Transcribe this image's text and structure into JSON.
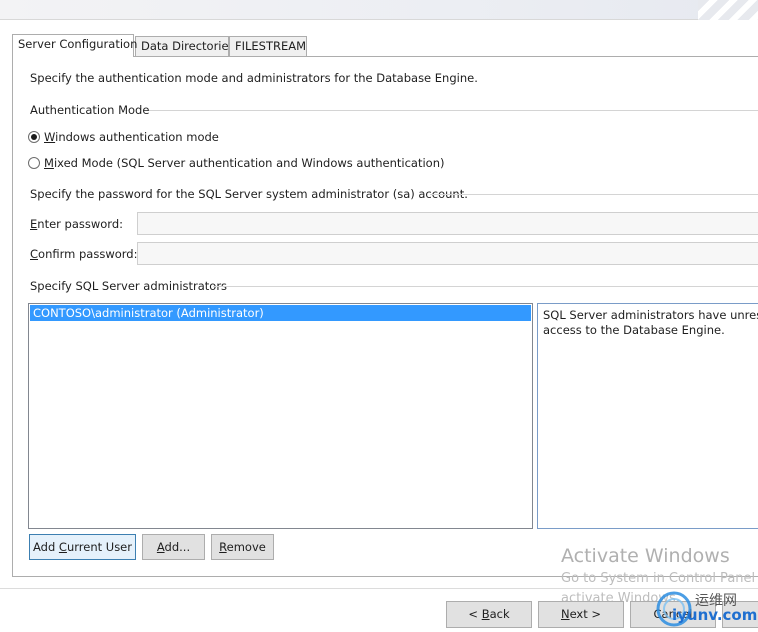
{
  "tabs": [
    {
      "label": "Server Configuration",
      "active": true
    },
    {
      "label": "Data Directories",
      "active": false
    },
    {
      "label": "FILESTREAM",
      "active": false
    }
  ],
  "server_config": {
    "description": "Specify the authentication mode and administrators for the Database Engine.",
    "auth_mode": {
      "group_label": "Authentication Mode",
      "windows": {
        "prefix": "",
        "accel": "W",
        "rest": "indows authentication mode",
        "checked": true
      },
      "mixed": {
        "prefix": "",
        "accel": "M",
        "rest": "ixed Mode (SQL Server authentication and Windows authentication)",
        "checked": false
      }
    },
    "sa_password": {
      "group_label": "Specify the password for the SQL Server system administrator (sa) account.",
      "enter": {
        "prefix": "",
        "accel": "E",
        "rest": "nter password:",
        "value": ""
      },
      "confirm": {
        "prefix": "",
        "accel": "C",
        "rest": "onfirm password:",
        "value": ""
      }
    },
    "admins": {
      "group_label": "Specify SQL Server administrators",
      "items": [
        "CONTOSO\\administrator (Administrator)"
      ],
      "info_line1": "SQL Server administrators have unrestrict",
      "info_line2": "access to the Database Engine."
    },
    "buttons": {
      "add_current_user": {
        "prefix": "Add ",
        "accel": "C",
        "rest": "urrent User"
      },
      "add": {
        "prefix": "",
        "accel": "A",
        "rest": "dd..."
      },
      "remove": {
        "prefix": "",
        "accel": "R",
        "rest": "emove"
      }
    }
  },
  "footer": {
    "back": {
      "prefix": "< ",
      "accel": "B",
      "rest": "ack"
    },
    "next": {
      "prefix": "",
      "accel": "N",
      "rest": "ext >"
    },
    "cancel": "Cancel"
  },
  "watermark": {
    "title": "Activate Windows",
    "line1": "Go to System in Control Panel",
    "line2": "activate Windows."
  },
  "site_logo": {
    "text_cn": "运维网",
    "domain": "iyunv.com",
    "colors": {
      "ring": "#2b8de0",
      "text": "#1f6fd0"
    }
  },
  "colors": {
    "selection": "#3399ff",
    "button_face": "#e1e1e1",
    "default_button_border": "#3c7fb1"
  }
}
